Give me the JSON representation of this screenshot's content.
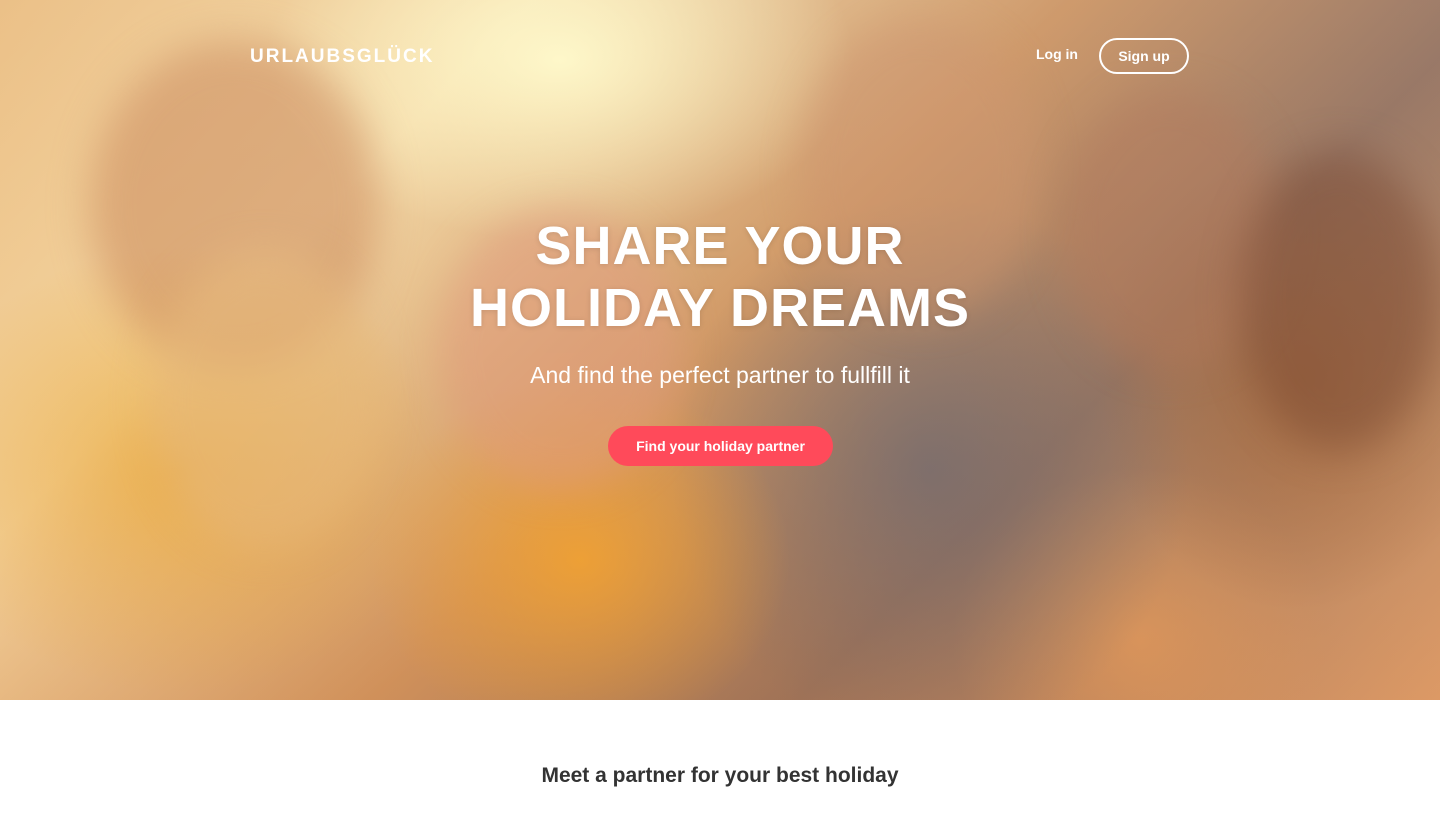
{
  "header": {
    "logo": "URLAUBSGLÜCK",
    "login_label": "Log in",
    "signup_label": "Sign up"
  },
  "hero": {
    "headline_line1": "SHARE YOUR",
    "headline_line2": "HOLIDAY DREAMS",
    "subheadline": "And find the perfect partner to fullfill it",
    "cta_label": "Find your holiday partner",
    "cta_color": "#ff4a5a"
  },
  "section": {
    "title": "Meet a partner for your best holiday"
  }
}
